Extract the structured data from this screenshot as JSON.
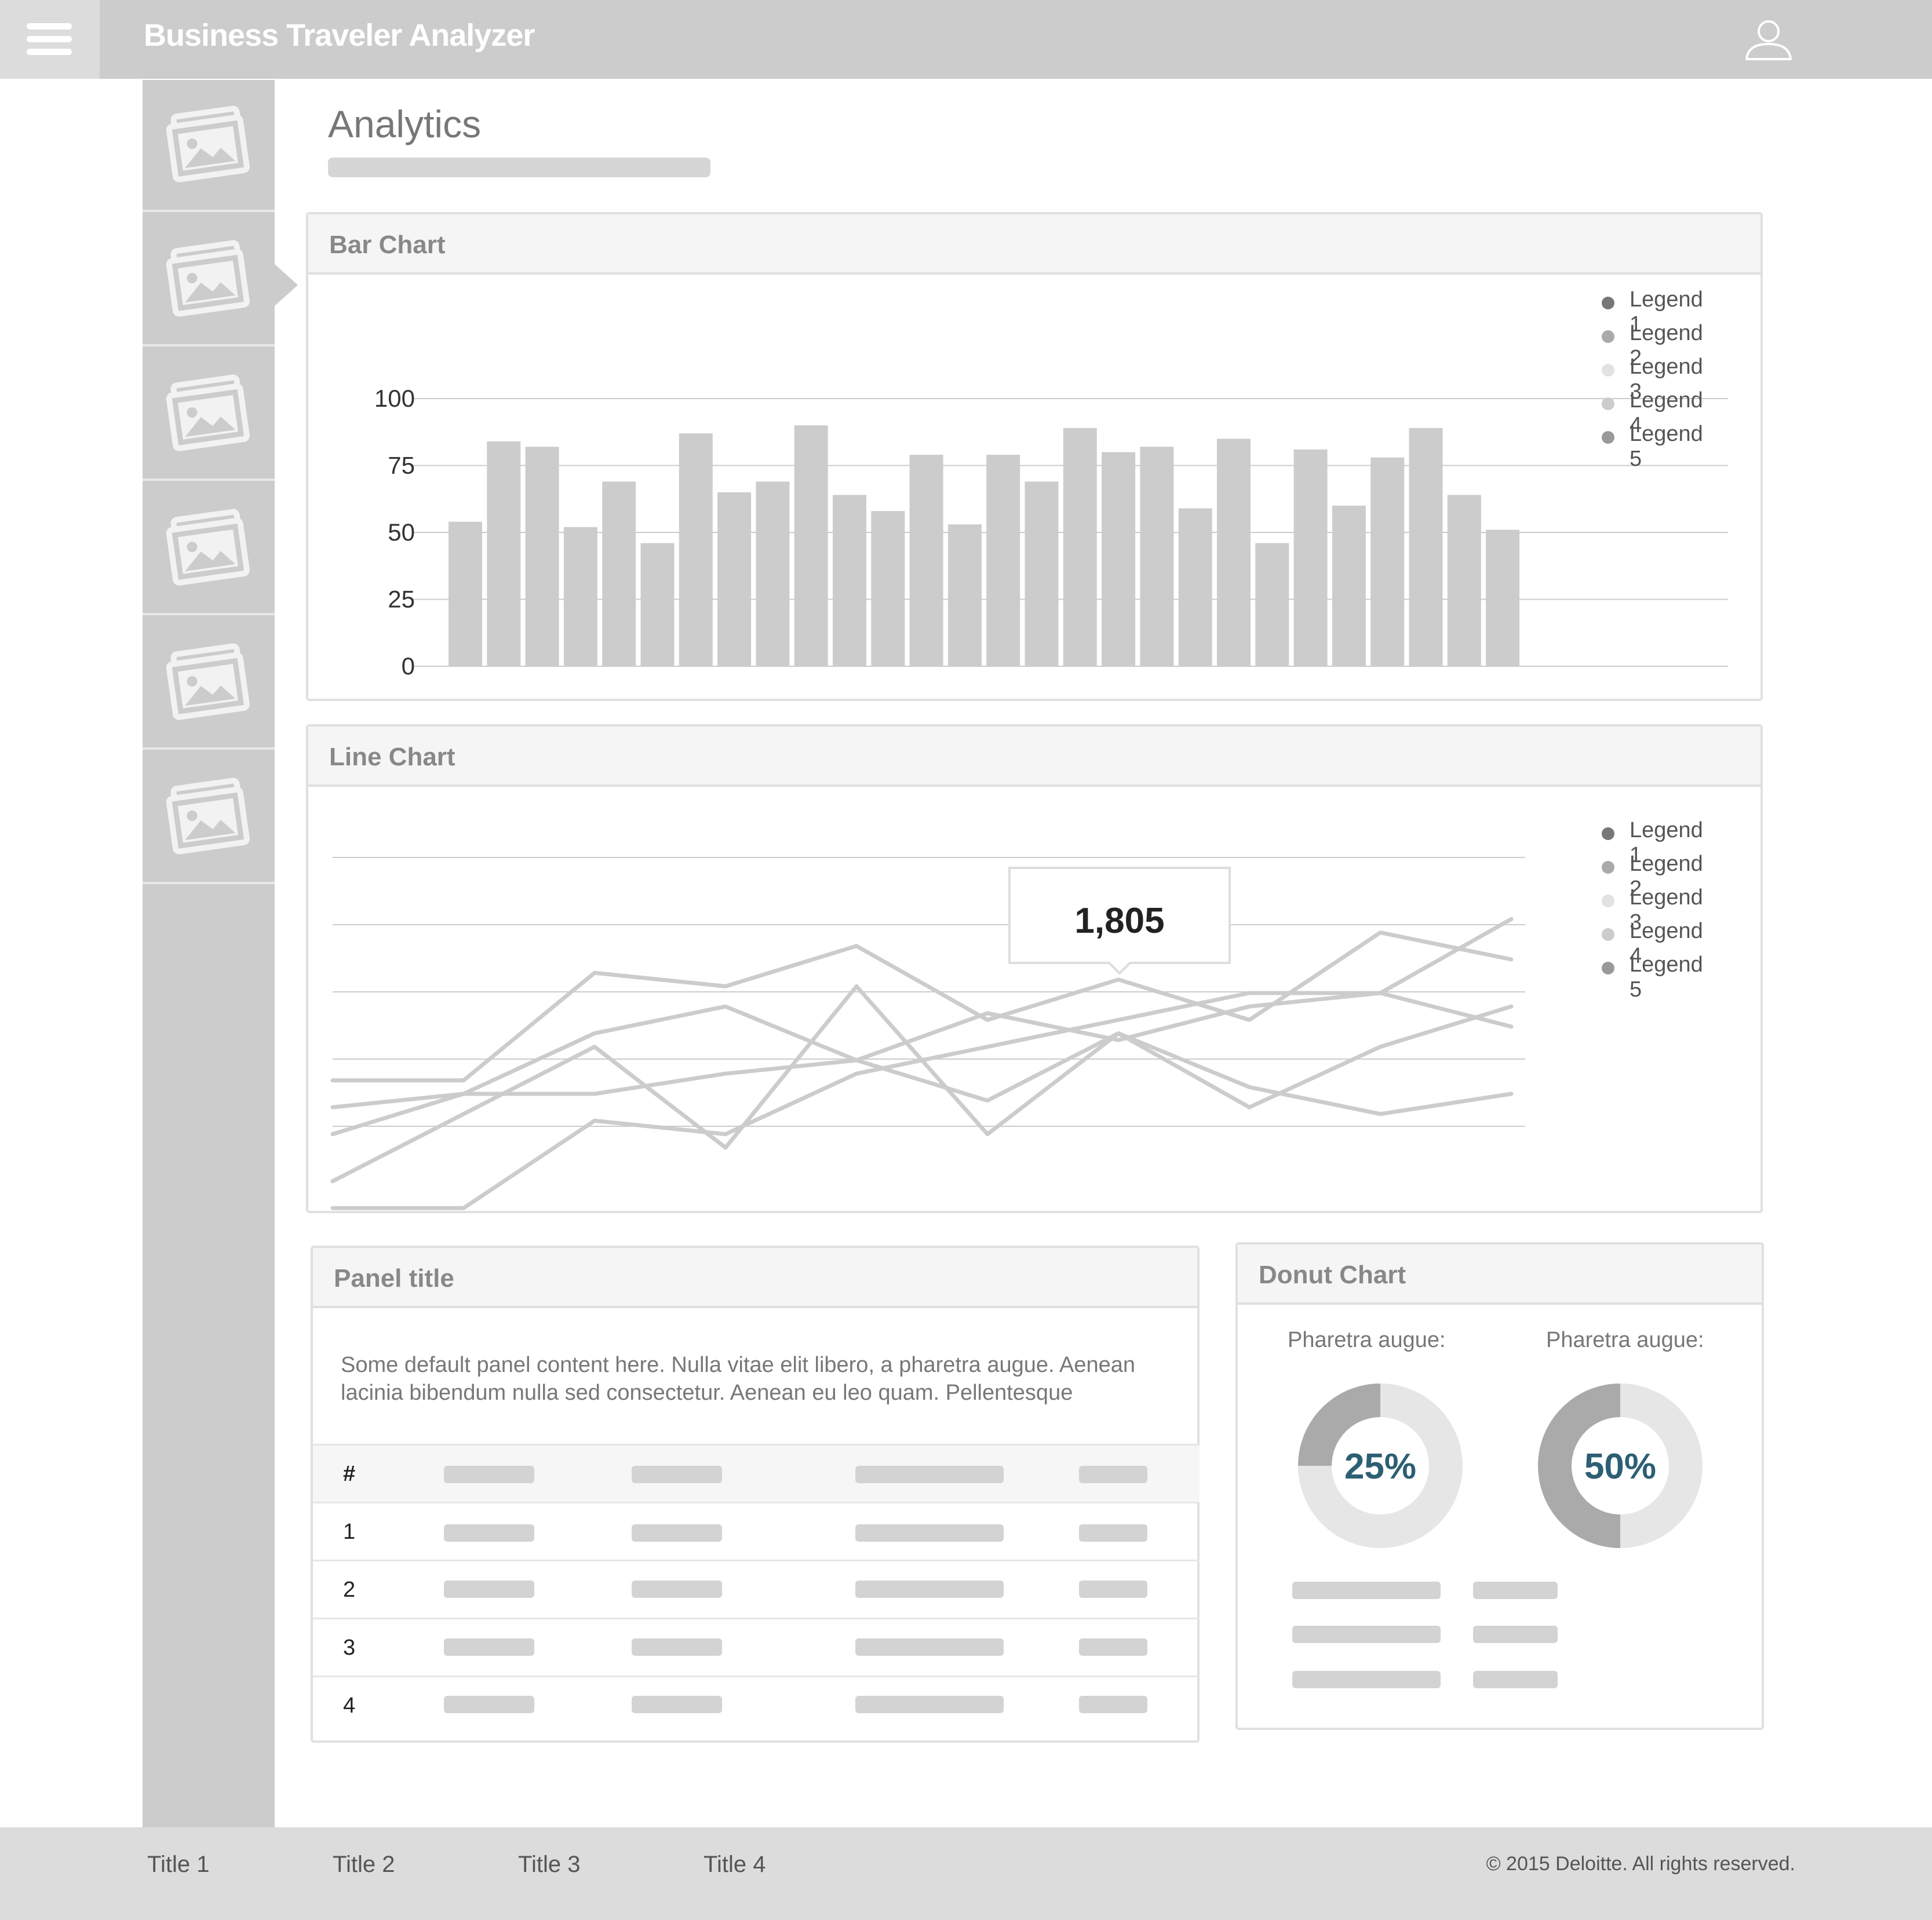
{
  "header": {
    "title": "Business Traveler Analyzer",
    "menu_icon": "hamburger-menu-icon",
    "user_icon": "user-profile-icon"
  },
  "sidebar": {
    "items": [
      {
        "icon": "image-icon",
        "active": false
      },
      {
        "icon": "image-icon",
        "active": true
      },
      {
        "icon": "image-icon",
        "active": false
      },
      {
        "icon": "image-icon",
        "active": false
      },
      {
        "icon": "image-icon",
        "active": false
      },
      {
        "icon": "image-icon",
        "active": false
      }
    ]
  },
  "page": {
    "title": "Analytics"
  },
  "bar_panel": {
    "title": "Bar Chart"
  },
  "line_panel": {
    "title": "Line Chart"
  },
  "table_panel": {
    "title": "Panel title",
    "text_line1": "Some default panel content here. Nulla vitae elit libero, a pharetra augue. Aenean",
    "text_line2": "lacinia bibendum nulla sed consectetur. Aenean eu leo quam. Pellentesque",
    "header": "#",
    "rows": [
      "1",
      "2",
      "3",
      "4"
    ]
  },
  "donut_panel": {
    "title": "Donut Chart"
  },
  "colors": {
    "bar": "#cccccc",
    "line": "#cccccc",
    "grid": "#cccccc",
    "donut_fill": "#aaaaaa",
    "donut_track": "#e6e6e6",
    "donut_text": "#2d5f73"
  },
  "chart_data": [
    {
      "type": "bar",
      "title": "Bar Chart",
      "categories": [],
      "values": [
        54,
        84,
        82,
        52,
        69,
        46,
        87,
        65,
        69,
        90,
        64,
        58,
        79,
        53,
        79,
        69,
        89,
        80,
        82,
        59,
        85,
        46,
        81,
        60,
        78,
        89,
        64,
        51
      ],
      "yticks": [
        "0",
        "25",
        "50",
        "75",
        "100"
      ],
      "ylim": [
        0,
        100
      ],
      "legend": [
        "Legend 1",
        "Legend 2",
        "Legend 3",
        "Legend 4",
        "Legend 5"
      ],
      "legend_colors": [
        "#777777",
        "#aaaaaa",
        "#e2e2e2",
        "#cccccc",
        "#999999"
      ],
      "legend_position": "top-right",
      "grid": true
    },
    {
      "type": "line",
      "title": "Line Chart",
      "x": [
        0,
        1,
        2,
        3,
        4,
        5,
        6,
        7,
        8,
        9
      ],
      "ylim": [
        0,
        6
      ],
      "series": [
        {
          "name": "Legend 1",
          "values": [
            2.2,
            2.2,
            3.8,
            3.6,
            4.2,
            3.1,
            3.7,
            3.1,
            4.4,
            4.0
          ]
        },
        {
          "name": "Legend 2",
          "values": [
            1.4,
            2.0,
            2.9,
            3.3,
            2.5,
            3.2,
            2.8,
            3.3,
            3.5,
            3.0
          ]
        },
        {
          "name": "Legend 3",
          "values": [
            0.3,
            0.3,
            1.6,
            1.4,
            2.3,
            2.7,
            3.1,
            3.5,
            3.5,
            4.6
          ]
        },
        {
          "name": "Legend 4",
          "values": [
            1.8,
            2.0,
            2.0,
            2.3,
            2.5,
            1.9,
            2.9,
            2.1,
            1.7,
            2.0
          ]
        },
        {
          "name": "Legend 5",
          "values": [
            0.7,
            1.7,
            2.7,
            1.2,
            3.6,
            1.4,
            2.9,
            1.8,
            2.7,
            3.3
          ]
        }
      ],
      "tooltip": {
        "value": "1,805"
      },
      "legend": [
        "Legend 1",
        "Legend 2",
        "Legend 3",
        "Legend 4",
        "Legend 5"
      ],
      "legend_colors": [
        "#777777",
        "#aaaaaa",
        "#e2e2e2",
        "#cccccc",
        "#999999"
      ],
      "legend_position": "top-right",
      "grid": true
    },
    {
      "type": "pie",
      "title": "Donut Chart",
      "donuts": [
        {
          "label": "Pharetra augue:",
          "value": 25,
          "text": "25%"
        },
        {
          "label": "Pharetra augue:",
          "value": 50,
          "text": "50%"
        }
      ]
    }
  ],
  "footer": {
    "links": [
      "Title 1",
      "Title 2",
      "Title 3",
      "Title 4"
    ],
    "copyright": "© 2015 Deloitte. All rights reserved."
  }
}
